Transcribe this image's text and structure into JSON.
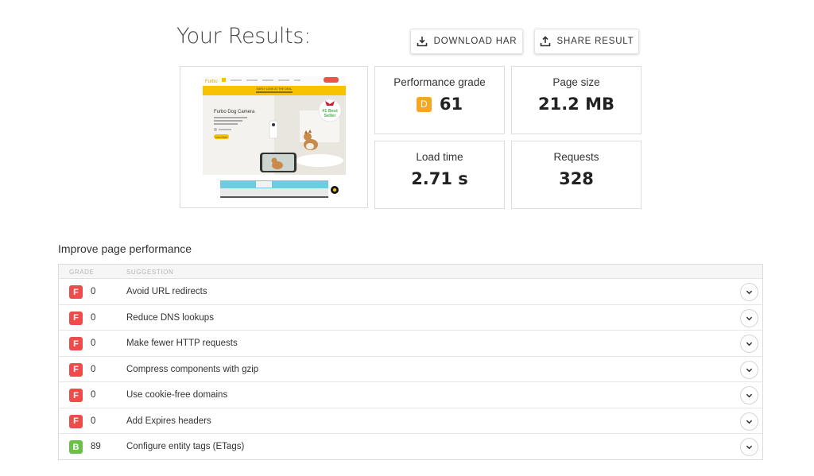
{
  "header": {
    "title": "Your Results:",
    "download_label": "DOWNLOAD HAR",
    "share_label": "SHARE RESULT"
  },
  "thumbnail": {
    "logo": "Furbo",
    "banner": "EARLY LOOK AT THE DEAL",
    "headline": "Furbo Dog Camera",
    "badge_line1": "#1 Best",
    "badge_line2": "Seller",
    "cta": "Learn More"
  },
  "stats": {
    "performance": {
      "label": "Performance grade",
      "grade": "D",
      "value": "61"
    },
    "page_size": {
      "label": "Page size",
      "value": "21.2 MB"
    },
    "load_time": {
      "label": "Load time",
      "value": "2.71 s"
    },
    "requests": {
      "label": "Requests",
      "value": "328"
    }
  },
  "improve": {
    "title": "Improve page performance",
    "col_grade": "GRADE",
    "col_suggestion": "SUGGESTION",
    "rows": [
      {
        "grade": "F",
        "score": "0",
        "suggestion": "Avoid URL redirects"
      },
      {
        "grade": "F",
        "score": "0",
        "suggestion": "Reduce DNS lookups"
      },
      {
        "grade": "F",
        "score": "0",
        "suggestion": "Make fewer HTTP requests"
      },
      {
        "grade": "F",
        "score": "0",
        "suggestion": "Compress components with gzip"
      },
      {
        "grade": "F",
        "score": "0",
        "suggestion": "Use cookie-free domains"
      },
      {
        "grade": "F",
        "score": "0",
        "suggestion": "Add Expires headers"
      },
      {
        "grade": "B",
        "score": "89",
        "suggestion": "Configure entity tags (ETags)"
      }
    ]
  },
  "colors": {
    "grade_f": "#f04b4b",
    "grade_b": "#6cc04a",
    "grade_d": "#f5a623",
    "thumb_accent": "#f7c300"
  },
  "icons": {
    "download": "download-icon",
    "share": "share-icon",
    "expand": "chevron-down-icon"
  }
}
